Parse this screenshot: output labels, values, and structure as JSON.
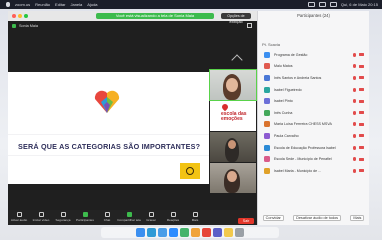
{
  "menubar": {
    "items": [
      "zoom.us",
      "Reunião",
      "Editar",
      "Janela",
      "Ajuda"
    ],
    "clock": "Qui, 6 de Maio 20:15"
  },
  "zoom_window": {
    "title": "Você está visualizando a tela de Sonia Maia",
    "view_option": "Opções de exibição",
    "share_info": "Sonia Maia",
    "slide": {
      "question": "SERÁ QUE AS CATEGORIAS SÃO IMPORTANTES?"
    },
    "escola_logo_text": "escola das emoções",
    "toolbar": [
      {
        "label": "Ativar áudio",
        "icon": "microphone-icon"
      },
      {
        "label": "Iniciar vídeo",
        "icon": "video-camera-icon"
      },
      {
        "label": "Segurança",
        "icon": "shield-icon"
      },
      {
        "label": "Participantes",
        "icon": "participants-icon"
      },
      {
        "label": "Chat",
        "icon": "chat-bubble-icon"
      },
      {
        "label": "Compartilhar tela",
        "icon": "share-screen-icon"
      },
      {
        "label": "Gravar",
        "icon": "record-icon"
      },
      {
        "label": "Reações",
        "icon": "reactions-icon"
      },
      {
        "label": "Mais",
        "icon": "more-icon"
      }
    ],
    "end_label": "Sair"
  },
  "participants_panel": {
    "title": "Participantes (24)",
    "count_label": "Pt. Scavia",
    "participants": [
      {
        "name": "Programa de Gestão",
        "color": "#3b8ff0"
      },
      {
        "name": "Malu Matos",
        "color": "#e05a4f"
      },
      {
        "name": "Inês Santos e Andreia Santos",
        "color": "#4a78d6"
      },
      {
        "name": "Isabel Figueiredo",
        "color": "#2aa7a0"
      },
      {
        "name": "Isabel Pinto",
        "color": "#6c6fd8"
      },
      {
        "name": "Inês Cunha",
        "color": "#43a85a"
      },
      {
        "name": "Maria Luísa Ferrreira CHESS MSVA",
        "color": "#d9732e"
      },
      {
        "name": "Paula Carvalho",
        "color": "#8d5bd1"
      },
      {
        "name": "Escola de Educação Professora Isabel",
        "color": "#2c8bd6"
      },
      {
        "name": "Escola Sede - Município de Penafiel",
        "color": "#d95c8a"
      },
      {
        "name": "Isabel Maria - Município de ...",
        "color": "#e0a129"
      }
    ],
    "footer": {
      "invite": "Convidar",
      "mute_all": "Desativar áudio de todos",
      "more": "Mais"
    }
  },
  "dock_icons": [
    "finder-icon",
    "safari-icon",
    "mail-icon",
    "zoom-icon",
    "maps-icon",
    "photos-icon",
    "chrome-icon",
    "teams-icon",
    "notes-icon",
    "trash-icon"
  ]
}
